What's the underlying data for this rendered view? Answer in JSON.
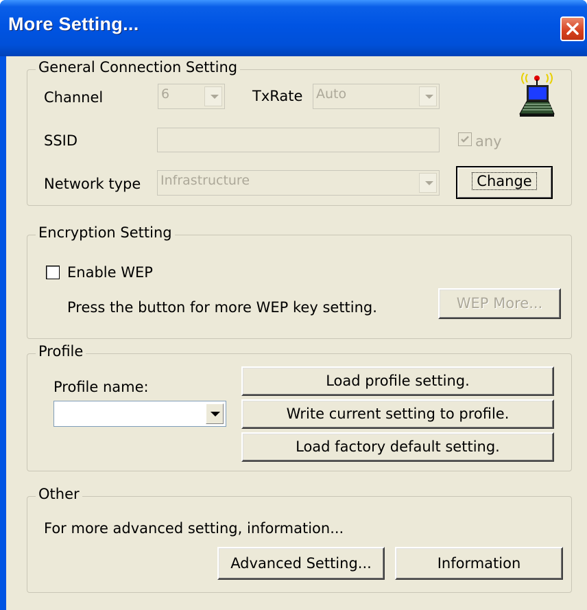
{
  "window": {
    "title": "More Setting..."
  },
  "general": {
    "legend": "General Connection Setting",
    "channel_label": "Channel",
    "channel_value": "6",
    "txrate_label": "TxRate",
    "txrate_value": "Auto",
    "ssid_label": "SSID",
    "ssid_value": "",
    "any_label": "any",
    "any_checked": true,
    "network_type_label": "Network type",
    "network_type_value": "Infrastructure",
    "change_button": "Change",
    "icon": "wireless-laptop-icon"
  },
  "encryption": {
    "legend": "Encryption Setting",
    "enable_wep_label": "Enable WEP",
    "enable_wep_checked": false,
    "hint": "Press the button for more WEP key setting.",
    "wep_more_button": "WEP More..."
  },
  "profile": {
    "legend": "Profile",
    "name_label": "Profile name:",
    "name_value": "",
    "load_button": "Load profile setting.",
    "write_button": "Write current setting to profile.",
    "factory_button": "Load factory default setting."
  },
  "other": {
    "legend": "Other",
    "text": "For more advanced setting, information...",
    "advanced_button": "Advanced Setting...",
    "information_button": "Information"
  },
  "colors": {
    "titlebar": "#0054e3",
    "dialog_bg": "#ece9d8",
    "close_button": "#d6401e",
    "disabled_text": "#aca899"
  }
}
